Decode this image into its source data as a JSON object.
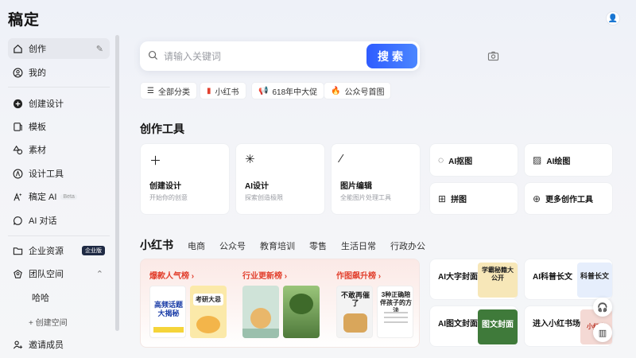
{
  "app": {
    "logo": "稿定"
  },
  "sidebar": {
    "items": [
      {
        "label": "创作",
        "icon": "home-icon"
      },
      {
        "label": "我的",
        "icon": "user-circle-icon"
      },
      {
        "label": "创建设计",
        "icon": "plus-circle-icon"
      },
      {
        "label": "模板",
        "icon": "template-icon"
      },
      {
        "label": "素材",
        "icon": "shapes-icon"
      },
      {
        "label": "设计工具",
        "icon": "compass-icon"
      },
      {
        "label": "稿定 AI",
        "icon": "ai-icon",
        "badge": "Beta"
      },
      {
        "label": "AI 对话",
        "icon": "chat-icon"
      },
      {
        "label": "企业资源",
        "icon": "folder-icon",
        "badge": "企业版"
      },
      {
        "label": "团队空间",
        "icon": "team-icon"
      },
      {
        "label": "哈哈"
      },
      {
        "label": "+ 创建空间"
      },
      {
        "label": "邀请成员",
        "icon": "invite-icon"
      }
    ]
  },
  "search": {
    "placeholder": "请输入关键词",
    "button": "搜索"
  },
  "chips": [
    {
      "label": "全部分类",
      "icon": "menu-icon"
    },
    {
      "label": "小红书",
      "icon": "book-icon"
    },
    {
      "label": "618年中大促",
      "icon": "megaphone-icon"
    },
    {
      "label": "公众号首图",
      "icon": "fire-icon"
    }
  ],
  "tools": {
    "title": "创作工具",
    "big": [
      {
        "title": "创建设计",
        "subtitle": "开始你的创意"
      },
      {
        "title": "AI设计",
        "subtitle": "探索创造极限"
      },
      {
        "title": "图片编辑",
        "subtitle": "全能图片处理工具"
      }
    ],
    "small": [
      {
        "label": "AI抠图"
      },
      {
        "label": "AI绘图"
      },
      {
        "label": "拼图"
      },
      {
        "label": "更多创作工具"
      }
    ]
  },
  "tabs": [
    "小红书",
    "电商",
    "公众号",
    "教育培训",
    "零售",
    "生活日常",
    "行政办公"
  ],
  "rankings": [
    {
      "title": "爆款人气榜 ›"
    },
    {
      "title": "行业更新榜 ›"
    },
    {
      "title": "作图飙升榜 ›"
    }
  ],
  "thumbs": {
    "t1": "高频话题大揭秘",
    "t2": "考研大忌",
    "t5": "不敢再催了",
    "t6": "3种正确陪伴孩子的方法"
  },
  "right_cards": [
    {
      "label": "AI大字封面",
      "img_text": "学霸秘籍大公开"
    },
    {
      "label": "AI科普长文",
      "img_text": "科普长文"
    },
    {
      "label": "AI图文封面",
      "img_text": "图文封面"
    },
    {
      "label": "进入小红书场景 ›",
      "img_text": "小红书"
    }
  ],
  "colors": {
    "accent": "#2f5cff",
    "hot": "#e2412f"
  }
}
